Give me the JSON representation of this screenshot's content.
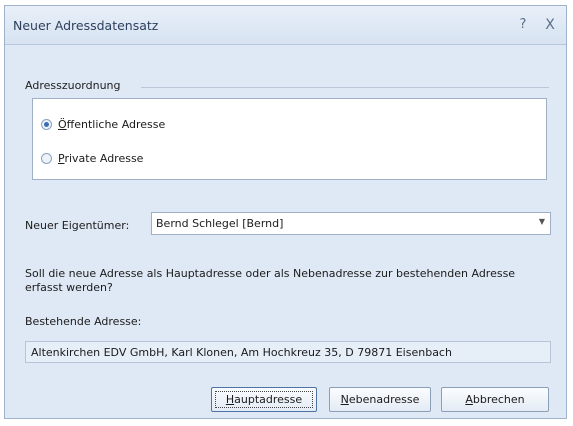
{
  "window": {
    "title": "Neuer Adressdatensatz",
    "help_glyph": "?",
    "close_glyph": "X"
  },
  "assignment": {
    "group_label": "Adresszuordnung",
    "options": [
      {
        "label_first": "Ö",
        "label_rest": "ffentliche Adresse",
        "selected": true
      },
      {
        "label_first": "P",
        "label_rest": "rivate Adresse",
        "selected": false
      }
    ]
  },
  "owner": {
    "label": "Neuer Eigentümer:",
    "value": "Bernd Schlegel [Bernd]",
    "dropdown_icon": "chevron-down-icon"
  },
  "question": "Soll die neue Adresse als Hauptadresse oder als Nebenadresse zur bestehenden Adresse erfasst werden?",
  "existing": {
    "label": "Bestehende Adresse:",
    "value": "Altenkirchen EDV GmbH, Karl Klonen, Am Hochkreuz 35, D 79871 Eisenbach"
  },
  "buttons": {
    "main_first": "H",
    "main_rest": "auptadresse",
    "neben_first": "N",
    "neben_rest": "ebenadresse",
    "cancel_first": "A",
    "cancel_rest": "bbrechen"
  }
}
